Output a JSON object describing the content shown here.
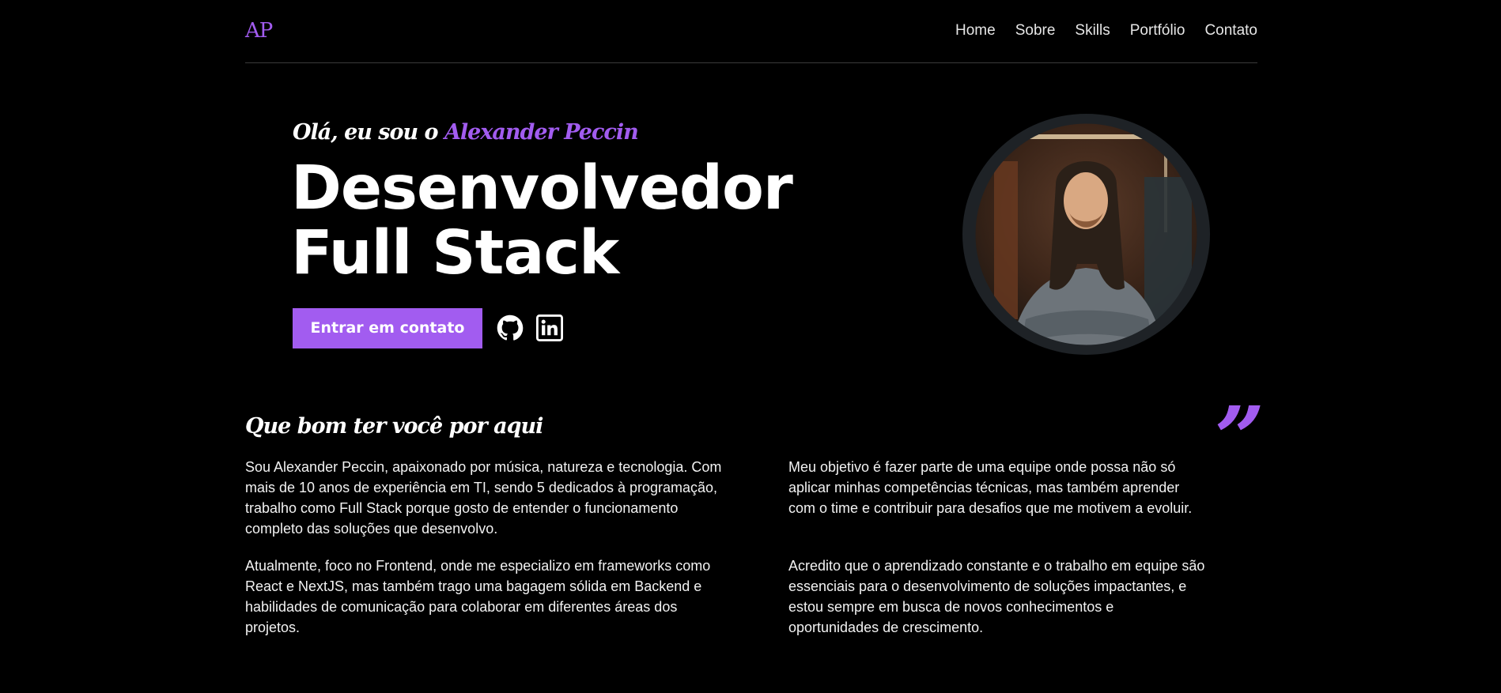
{
  "header": {
    "logo": "AP",
    "nav": [
      "Home",
      "Sobre",
      "Skills",
      "Portfólio",
      "Contato"
    ]
  },
  "hero": {
    "greeting_prefix": "Olá, eu sou o",
    "greeting_name": "Alexander Peccin",
    "headline_line1": "Desenvolvedor",
    "headline_line2": "Full Stack",
    "cta_label": "Entrar em contato",
    "social_icons": [
      "github-icon",
      "linkedin-icon"
    ]
  },
  "about": {
    "title": "Que bom ter você por aqui",
    "quote_mark": "”",
    "paragraphs": [
      "Sou Alexander Peccin, apaixonado por música, natureza e tecnologia. Com mais de 10 anos de experiência em TI, sendo 5 dedicados à programação, trabalho como Full Stack porque gosto de entender o funcionamento completo das soluções que desenvolvo.",
      "Atualmente, foco no Frontend, onde me especializo em frameworks como React e NextJS, mas também trago uma bagagem sólida em Backend e habilidades de comunicação para colaborar em diferentes áreas dos projetos.",
      "Meu objetivo é fazer parte de uma equipe onde possa não só aplicar minhas competências técnicas, mas também aprender com o time e contribuir para desafios que me motivem a evoluir.",
      "Acredito que o aprendizado constante e o trabalho em equipe são essenciais para o desenvolvimento de soluções impactantes, e estou sempre em busca de novos conhecimentos e oportunidades de crescimento."
    ]
  },
  "colors": {
    "accent": "#a25cf0",
    "background": "#000000",
    "text": "#ffffff"
  }
}
